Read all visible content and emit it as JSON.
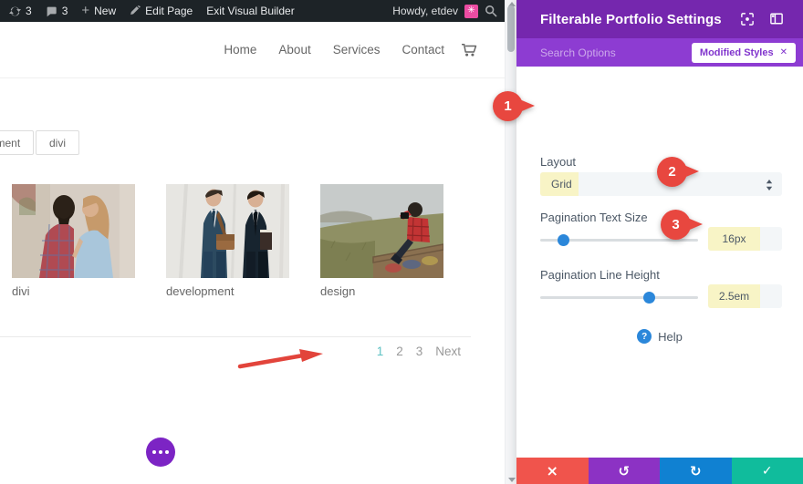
{
  "colors": {
    "adminbar_bg": "#1d2327",
    "panel_header_purple": "#7527ae",
    "panel_search_purple": "#8d3cd2",
    "accent_blue": "#2b87da",
    "modified_highlight_yellow": "#f8f4c6",
    "callout_red": "#e8473f",
    "pagination_active_teal": "#5ec2c4",
    "footer_cancel_red": "#f0544c",
    "footer_undo_purple": "#8c32c4",
    "footer_redo_blue": "#1081d2",
    "footer_save_green": "#10bc9c",
    "builder_dots_purple": "#7c24c4",
    "avatar_pink": "#ec4ca2"
  },
  "admin_bar": {
    "updates_count": "3",
    "comments_count": "3",
    "new_icon": "+",
    "new_label": "New",
    "edit_page_label": "Edit Page",
    "exit_builder_label": "Exit Visual Builder",
    "howdy_label": "Howdy, etdev",
    "avatar_glyph": "✳"
  },
  "site_nav": {
    "items": [
      "Home",
      "About",
      "Services",
      "Contact"
    ]
  },
  "filters": {
    "buttons": [
      "pment",
      "divi"
    ]
  },
  "portfolio": {
    "items": [
      {
        "label": "divi"
      },
      {
        "label": "development"
      },
      {
        "label": "design"
      }
    ]
  },
  "pagination": {
    "pages": [
      "1",
      "2",
      "3"
    ],
    "next_label": "Next",
    "active_page": "1"
  },
  "panel": {
    "title": "Filterable Portfolio Settings",
    "search_placeholder": "Search Options",
    "modified_styles_label": "Modified Styles",
    "close_filter_icon": "✕",
    "layout": {
      "label": "Layout",
      "value": "Grid"
    },
    "pagination_text_size": {
      "label": "Pagination Text Size",
      "value": "16px"
    },
    "pagination_line_height": {
      "label": "Pagination Line Height",
      "value": "2.5em"
    },
    "help_icon": "?",
    "help_label": "Help",
    "callouts": [
      "1",
      "2",
      "3"
    ],
    "footer": {
      "cancel_icon": "×",
      "undo_icon": "↺",
      "redo_icon": "↻",
      "save_icon": "✓"
    }
  }
}
